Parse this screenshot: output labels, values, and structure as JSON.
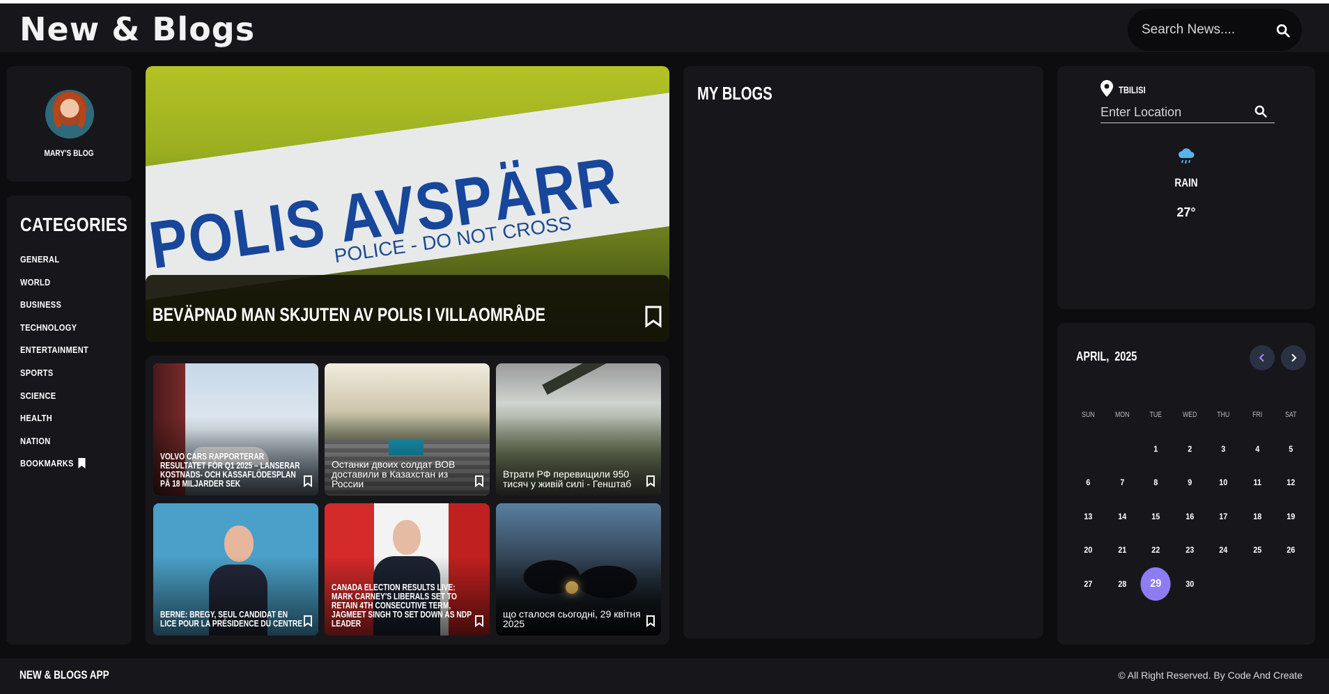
{
  "header": {
    "title": "New & Blogs",
    "search_placeholder": "Search News...."
  },
  "profile": {
    "name": "MARY'S BLOG"
  },
  "categories": {
    "title": "CATEGORIES",
    "items": [
      "GENERAL",
      "WORLD",
      "BUSINESS",
      "TECHNOLOGY",
      "ENTERTAINMENT",
      "SPORTS",
      "SCIENCE",
      "HEALTH",
      "NATION",
      "BOOKMARKS"
    ]
  },
  "hero": {
    "headline": "BEVÄPNAD MAN SKJUTEN AV POLIS I VILLAOMRÅDE",
    "image_text": "POLIS AVSPÄRR",
    "image_subtext": "POLICE - DO NOT CROSS"
  },
  "news_cards": [
    {
      "title": "VOLVO CARS RAPPORTERAR RESULTATET FÖR Q1 2025 – LANSERAR KOSTNADS- OCH KASSAFLÖDESPLAN PÅ 18 MILJARDER SEK"
    },
    {
      "title": "Останки двоих солдат ВОВ доставили в Казахстан из России"
    },
    {
      "title": "Втрати РФ перевищили 950 тисяч у живій силі - Генштаб"
    },
    {
      "title": "BERNE: BREGY, SEUL CANDIDAT EN LICE POUR LA PRÉSIDENCE DU CENTRE"
    },
    {
      "title": "CANADA ELECTION RESULTS LIVE: MARK CARNEY'S LIBERALS SET TO RETAIN 4TH CONSECUTIVE TERM, JAGMEET SINGH TO SET DOWN AS NDP LEADER"
    },
    {
      "title": "що сталося сьогодні, 29 квітня 2025"
    }
  ],
  "blogs": {
    "title": "MY BLOGS"
  },
  "weather": {
    "city": "TBILISI",
    "location_placeholder": "Enter Location",
    "condition": "RAIN",
    "temperature": "27°",
    "icon": "rain-cloud-icon",
    "icon_color": "#5ab4e6"
  },
  "calendar": {
    "month_label": "APRIL,  2025",
    "weekdays": [
      "SUN",
      "MON",
      "TUE",
      "WED",
      "THU",
      "FRI",
      "SAT"
    ],
    "leading_blanks": 2,
    "days": [
      "1",
      "2",
      "3",
      "4",
      "5",
      "6",
      "7",
      "8",
      "9",
      "10",
      "11",
      "12",
      "13",
      "14",
      "15",
      "16",
      "17",
      "18",
      "19",
      "20",
      "21",
      "22",
      "23",
      "24",
      "25",
      "26",
      "27",
      "28",
      "29",
      "30"
    ],
    "today": "29",
    "accent": "#8d7cf2"
  },
  "footer": {
    "left": "NEW & BLOGS APP",
    "right": "© All Right Reserved. By Code And Create"
  }
}
